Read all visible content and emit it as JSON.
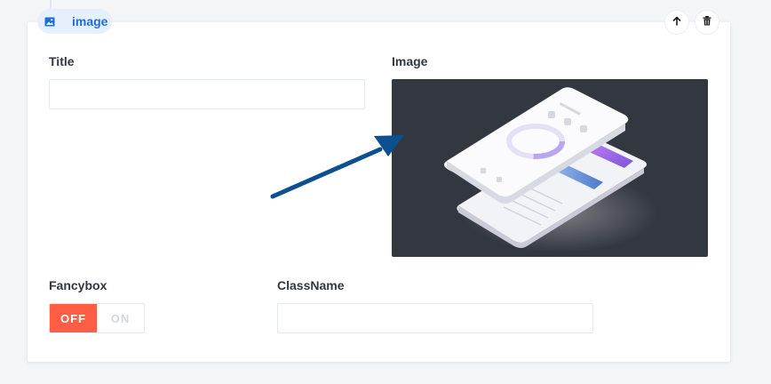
{
  "block": {
    "label": "image",
    "icon": "image-icon"
  },
  "actions": {
    "move_up_icon": "arrow-up-icon",
    "delete_icon": "trash-icon"
  },
  "fields": {
    "title": {
      "label": "Title",
      "value": "",
      "placeholder": ""
    },
    "image": {
      "label": "Image",
      "preview": "phone-mockup-image"
    },
    "fancybox": {
      "label": "Fancybox",
      "off_label": "OFF",
      "on_label": "ON",
      "value": "off"
    },
    "classname": {
      "label": "ClassName",
      "value": "",
      "placeholder": ""
    }
  },
  "colors": {
    "accent": "#1f6ed4",
    "chip_bg": "#e5f0fc",
    "toggle_off": "#ff5d44",
    "preview_bg": "#333740",
    "annotation_arrow": "#0d4f8f"
  }
}
